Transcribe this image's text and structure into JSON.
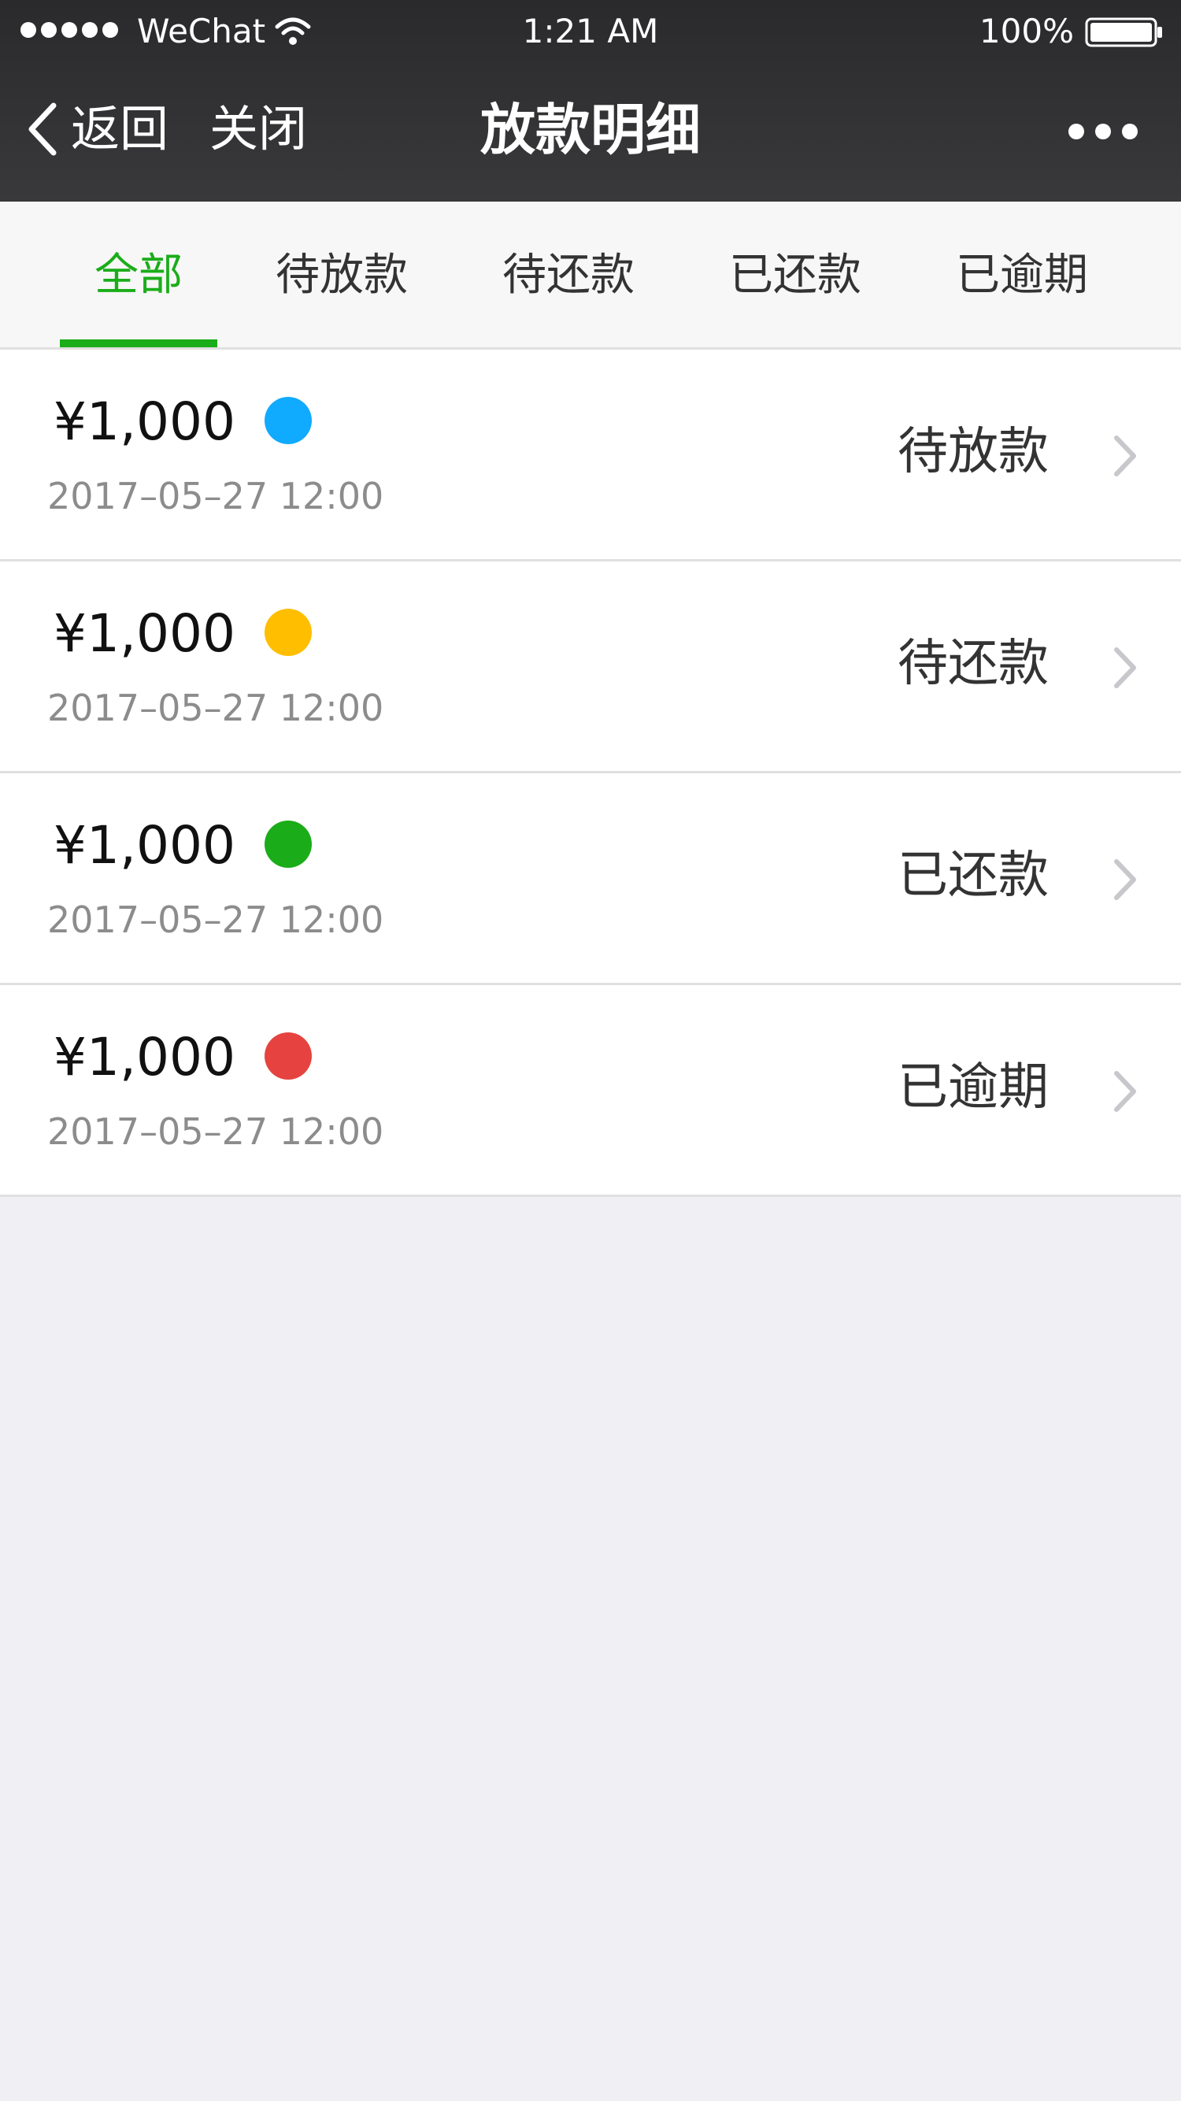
{
  "status_bar": {
    "carrier": "WeChat",
    "time": "1:21 AM",
    "battery": "100%"
  },
  "nav": {
    "back_label": "返回",
    "close_label": "关闭",
    "title": "放款明细"
  },
  "tabs": [
    {
      "label": "全部",
      "active": true
    },
    {
      "label": "待放款",
      "active": false
    },
    {
      "label": "待还款",
      "active": false
    },
    {
      "label": "已还款",
      "active": false
    },
    {
      "label": "已逾期",
      "active": false
    }
  ],
  "records": [
    {
      "amount": "¥1,000",
      "date": "2017–05–27 12:00",
      "status": "待放款",
      "dot_color": "#10aaff"
    },
    {
      "amount": "¥1,000",
      "date": "2017–05–27 12:00",
      "status": "待还款",
      "dot_color": "#ffbe00"
    },
    {
      "amount": "¥1,000",
      "date": "2017–05–27 12:00",
      "status": "已还款",
      "dot_color": "#1aad19"
    },
    {
      "amount": "¥1,000",
      "date": "2017–05–27 12:00",
      "status": "已逾期",
      "dot_color": "#e64340"
    }
  ],
  "colors": {
    "accent": "#1aad19",
    "header_bg": "#2f2f31",
    "page_bg": "#efeff4"
  }
}
